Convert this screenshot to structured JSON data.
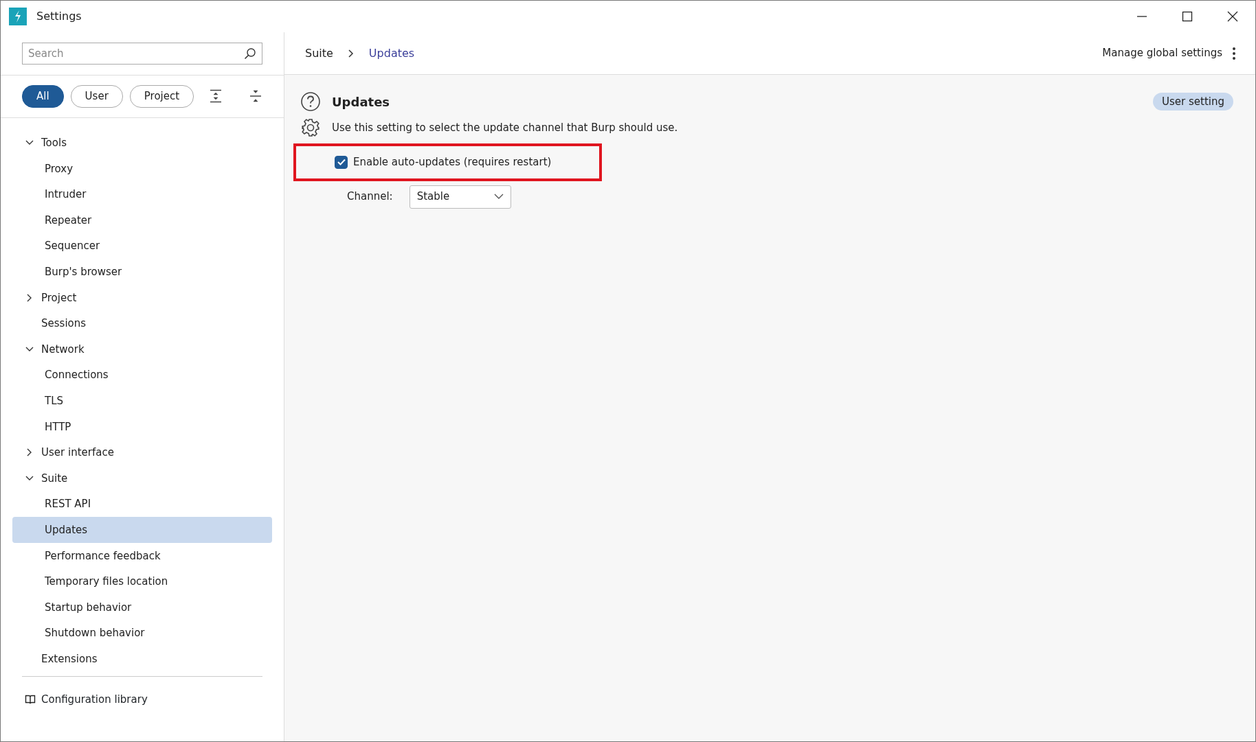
{
  "window": {
    "title": "Settings"
  },
  "sidebar": {
    "search": {
      "placeholder": "Search"
    },
    "filters": [
      {
        "label": "All",
        "selected": true
      },
      {
        "label": "User",
        "selected": false
      },
      {
        "label": "Project",
        "selected": false
      }
    ],
    "tree": [
      {
        "label": "Tools",
        "expanded": true,
        "selected": false,
        "children": [
          {
            "label": "Proxy",
            "selected": false
          },
          {
            "label": "Intruder",
            "selected": false
          },
          {
            "label": "Repeater",
            "selected": false
          },
          {
            "label": "Sequencer",
            "selected": false
          },
          {
            "label": "Burp's browser",
            "selected": false
          }
        ]
      },
      {
        "label": "Project",
        "expanded": false,
        "selected": false
      },
      {
        "label": "Sessions",
        "selected": false
      },
      {
        "label": "Network",
        "expanded": true,
        "selected": false,
        "children": [
          {
            "label": "Connections",
            "selected": false
          },
          {
            "label": "TLS",
            "selected": false
          },
          {
            "label": "HTTP",
            "selected": false
          }
        ]
      },
      {
        "label": "User interface",
        "expanded": false,
        "selected": false
      },
      {
        "label": "Suite",
        "expanded": true,
        "selected": false,
        "children": [
          {
            "label": "REST API",
            "selected": false
          },
          {
            "label": "Updates",
            "selected": true
          },
          {
            "label": "Performance feedback",
            "selected": false
          },
          {
            "label": "Temporary files location",
            "selected": false
          },
          {
            "label": "Startup behavior",
            "selected": false
          },
          {
            "label": "Shutdown behavior",
            "selected": false
          }
        ]
      },
      {
        "label": "Extensions",
        "selected": false
      }
    ],
    "footer_link": "Configuration library"
  },
  "breadcrumb": [
    {
      "label": "Suite",
      "current": false
    },
    {
      "label": "Updates",
      "current": true
    }
  ],
  "manage_link": "Manage global settings",
  "section": {
    "title": "Updates",
    "scope_badge": "User setting",
    "description": "Use this setting to select the update channel that Burp should use.",
    "checkbox": {
      "label": "Enable auto-updates (requires restart)",
      "checked": true,
      "highlighted": true
    },
    "channel": {
      "label": "Channel:",
      "value": "Stable"
    }
  }
}
